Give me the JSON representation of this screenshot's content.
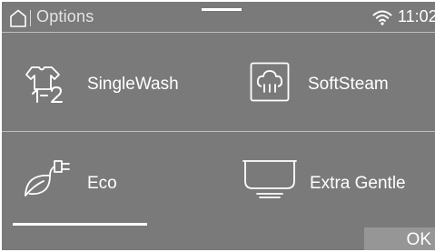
{
  "statusbar": {
    "title": "Options",
    "time": "11:02"
  },
  "options": [
    {
      "label": "SingleWash",
      "icon": "single-wash-icon"
    },
    {
      "label": "SoftSteam",
      "icon": "soft-steam-icon"
    },
    {
      "label": "Eco",
      "icon": "eco-icon"
    },
    {
      "label": "Extra Gentle",
      "icon": "extra-gentle-icon"
    }
  ],
  "footer": {
    "ok_label": "OK"
  },
  "colors": {
    "background": "#7a7a7a",
    "text": "#ffffff",
    "ok_button": "#969696"
  }
}
